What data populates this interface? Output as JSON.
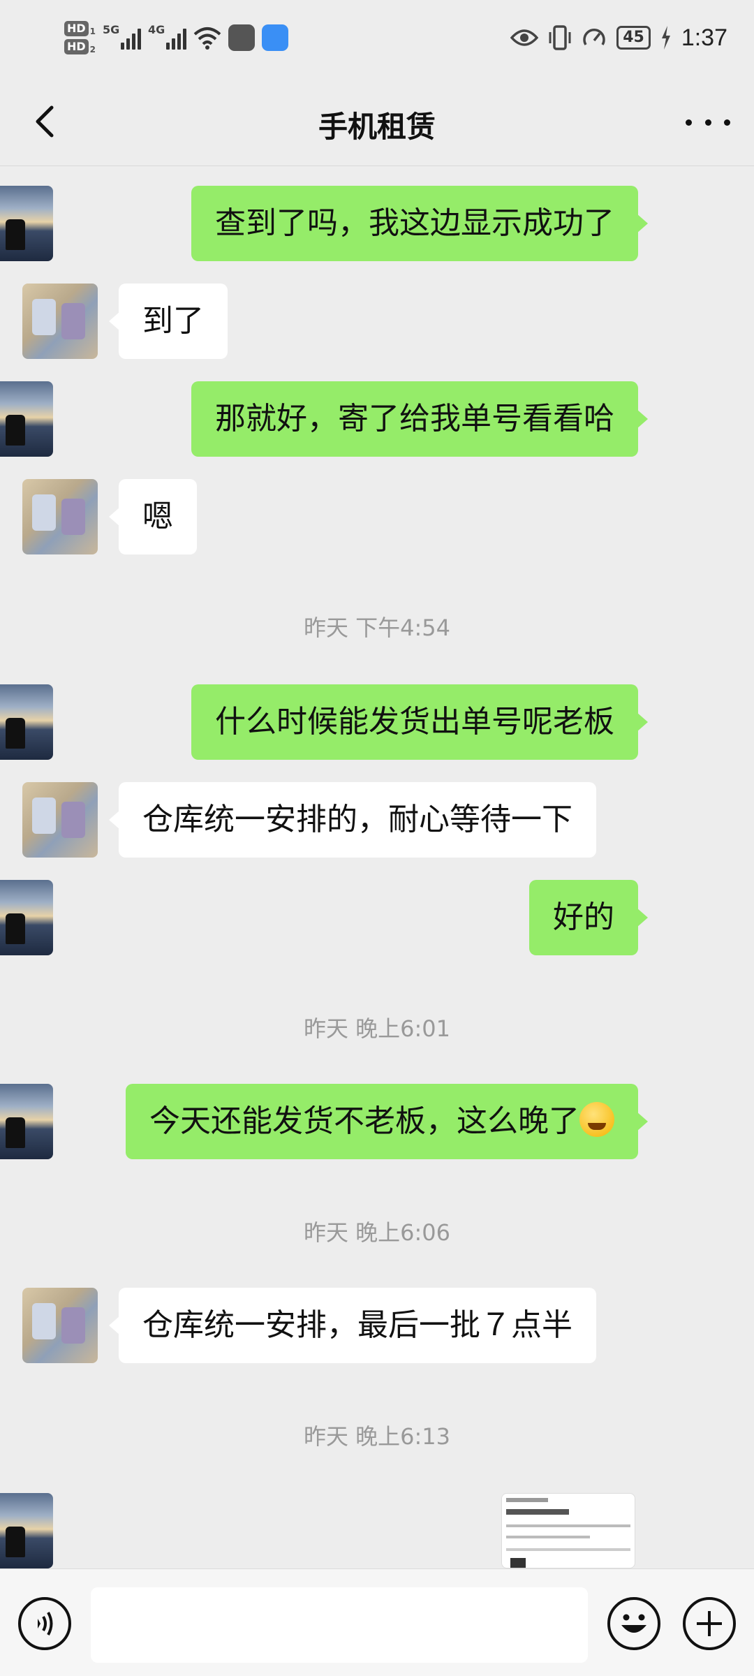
{
  "status_bar": {
    "hd1": "HD",
    "hd1_num": "1",
    "hd2": "HD",
    "hd2_num": "2",
    "sig1_tag": "5G",
    "sig2_tag": "4G",
    "battery": "45",
    "time": "1:37",
    "icons": [
      "wifi-icon",
      "speedometer-app-icon",
      "cloud-app-icon",
      "eye-icon",
      "vibrate-icon",
      "data-saver-icon",
      "battery-icon",
      "charging-icon"
    ]
  },
  "header": {
    "title": "手机租赁"
  },
  "messages": [
    {
      "side": "me",
      "text": "查到了吗，我这边显示成功了"
    },
    {
      "side": "other",
      "text": "到了"
    },
    {
      "side": "me",
      "text": "那就好，寄了给我单号看看哈"
    },
    {
      "side": "other",
      "text": "嗯"
    },
    {
      "type": "time",
      "text": "昨天 下午4:54"
    },
    {
      "side": "me",
      "text": "什么时候能发货出单号呢老板"
    },
    {
      "side": "other",
      "text": "仓库统一安排的，耐心等待一下"
    },
    {
      "side": "me",
      "text": "好的"
    },
    {
      "type": "time",
      "text": "昨天 晚上6:01"
    },
    {
      "side": "me",
      "text": "今天还能发货不老板，这么晚了",
      "emoji": "crying-laughing-emoji"
    },
    {
      "type": "time",
      "text": "昨天 晚上6:06"
    },
    {
      "side": "other",
      "text": "仓库统一安排，最后一批７点半"
    },
    {
      "type": "time",
      "text": "昨天 晚上6:13"
    },
    {
      "side": "me",
      "type": "image",
      "text": "订单截图"
    }
  ],
  "colors": {
    "background": "#ededed",
    "my_bubble": "#95ec69",
    "other_bubble": "#ffffff",
    "timestamp": "#999999"
  },
  "input_bar": {
    "placeholder": "",
    "icons": [
      "voice-icon",
      "emoji-icon",
      "plus-icon"
    ]
  }
}
